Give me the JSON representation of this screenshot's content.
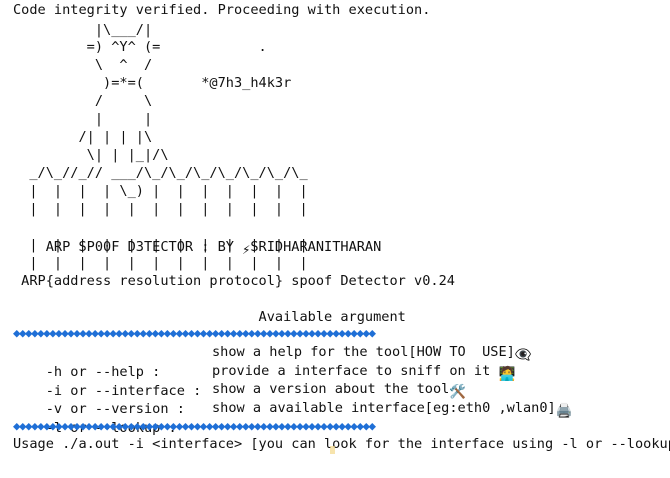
{
  "terminal": {
    "status": "Code integrity verified. Proceeding with execution.",
    "ascii_art": [
      "          |\\___/|",
      "         =) ^Y^ (=            .",
      "          \\  ^  /",
      "           )=*=(       *@7h3_h4k3r",
      "          /     \\",
      "          |     |",
      "        /| | | |\\",
      "         \\| | |_|/\\",
      "  _/\\_//_// ___/\\_/\\_/\\_/\\_/\\_/\\_/\\_",
      "  |  |  |  | \\_) |  |  |  |  |  |  |",
      "  |  |  |  |  |  |  |  |  |  |  |  |"
    ],
    "banner_prefix": "ARP SP00F D3TECTOR : BY ",
    "banner_author": "SRIDHARANITHARAN",
    "ascii_art_bottom": [
      "  |  |  |  |  |  |  |  |  |  |  |  |",
      "  |  |  |  |  |  |  |  |  |  |  |  |"
    ],
    "subtitle": " ARP{address resolution protocol} spoof Detector v0.24",
    "available_heading": "                              Available argument",
    "diamond_row": "◆◆◆◆◆◆◆◆◆◆◆◆◆◆◆◆◆◆◆◆◆◆◆◆◆◆◆◆◆◆◆◆◆◆◆◆◆◆◆◆◆◆◆◆◆◆◆◆◆◆◆◆◆◆◆◆◆◆◆◆",
    "arguments": [
      {
        "flag": "-h or --help :",
        "desc": "show a help for the tool[HOW TO  USE]",
        "emoji": "👁️‍🗨️"
      },
      {
        "flag": "-i or --interface :",
        "desc": "provide a interface to sniff on it ",
        "emoji": "🧑‍💻"
      },
      {
        "flag": "-v or --version :",
        "desc": "show a version about the tool",
        "emoji": "🛠️"
      },
      {
        "flag": "-l or --lookup :",
        "desc": "show a available interface[eg:eth0 ,wlan0]",
        "emoji": "🖨️"
      }
    ],
    "usage": "Usage ./a.out -i <interface> [you can look for the interface using -l or --lookup"
  },
  "colors": {
    "text": "#111111",
    "diamond": "#1f6fd6",
    "background": "#ffffff"
  },
  "icons": {
    "lightning": "lightning-icon"
  }
}
